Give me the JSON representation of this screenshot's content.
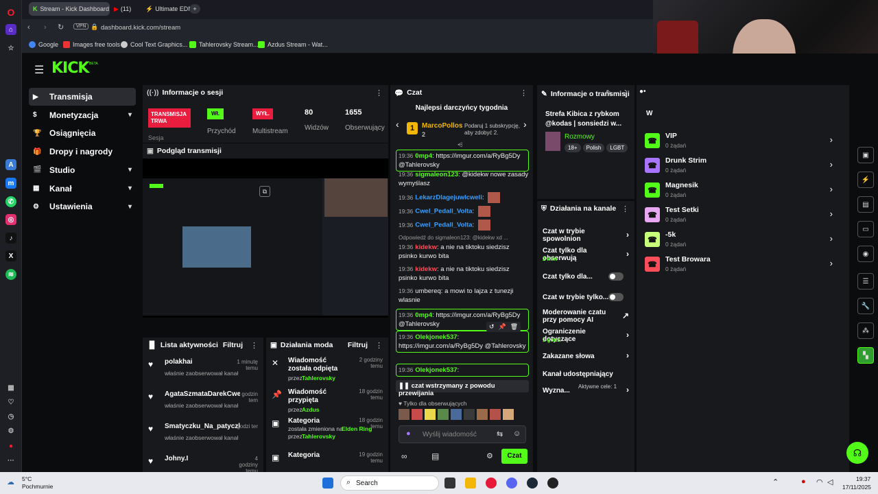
{
  "browser": {
    "tabs": [
      {
        "label": "Stream - Kick Dashboard"
      },
      {
        "label": "(11)"
      },
      {
        "label": "Ultimate EDM"
      }
    ],
    "url": "dashboard.kick.com/stream",
    "vpn": "VPN",
    "bookmarks": [
      "Google",
      "Images free tools",
      "Cool Text Graphics...",
      "Tahlerovsky Stream...",
      "Azdus Stream - Wat..."
    ]
  },
  "kick": {
    "logo": "KICK",
    "beta": "BETA"
  },
  "nav": [
    {
      "label": "Transmisja",
      "chev": ""
    },
    {
      "label": "Monetyzacja",
      "chev": "▾"
    },
    {
      "label": "Osiągnięcia",
      "chev": ""
    },
    {
      "label": "Dropy i nagrody",
      "chev": ""
    },
    {
      "label": "Studio",
      "chev": "▾"
    },
    {
      "label": "Kanał",
      "chev": "▾"
    },
    {
      "label": "Ustawienia",
      "chev": "▾"
    }
  ],
  "session": {
    "title": "Informacje o sesji",
    "badge1": "TRANSMISJA TRWA",
    "badge1_sub": "Sesja",
    "badge2": "Wł.",
    "badge2_sub": "Przychód",
    "badge3": "WYŁ.",
    "badge3_sub": "Multistream",
    "viewers": "80",
    "viewers_label": "Widzów",
    "followers": "1655",
    "followers_label": "Obserwujący"
  },
  "preview": {
    "title": "Podgląd transmisji"
  },
  "activity": {
    "title": "Lista aktywności",
    "filter": "Filtruj",
    "items": [
      {
        "name": "polakhai",
        "time": "1 minutę temu",
        "desc": "właśnie zaobserwował kanał"
      },
      {
        "name": "AgataSzmataDarekCwel",
        "time": "godzin tem",
        "desc": "właśnie zaobserwował kanał"
      },
      {
        "name": "Smatyczku_Na_patyczku",
        "time": "godzi ter",
        "desc": "właśnie zaobserwował kanał"
      },
      {
        "name": "Johny.I",
        "time": "4 godziny temu",
        "desc": ""
      }
    ]
  },
  "mod": {
    "title": "Działania moda",
    "filter": "Filtruj",
    "items": [
      {
        "title": "Wiadomość została odpięta",
        "by_label": "przez",
        "by": "Tahlerovsky",
        "time": "2 godziny temu",
        "extra_label": "",
        "extra": ""
      },
      {
        "title": "Wiadomość przypięta",
        "by_label": "przez",
        "by": "Azdus",
        "time": "18 godzin temu",
        "extra_label": "",
        "extra": ""
      },
      {
        "title": "Kategoria",
        "by_label": "przez",
        "by": "Tahlerovsky",
        "time": "18 godzin temu",
        "extra_label": "została zmieniona na",
        "extra": "Elden Ring"
      },
      {
        "title": "Kategoria",
        "by_label": "",
        "by": "",
        "time": "19 godzin temu",
        "extra_label": "",
        "extra": ""
      }
    ]
  },
  "chat": {
    "title": "Czat",
    "top_title": "Najlepsi darczyńcy tygodnia",
    "top_user": "MarcoPollos",
    "top_rank": "1",
    "top_count": "2",
    "top_desc": "Podaruj 1 subskrypcję, aby zdobyć 2.",
    "messages": [
      {
        "time": "19:36",
        "user": "0mp4",
        "text": "https://imgur.com/a/RyBg5Dy @Tahlerovsky"
      },
      {
        "time": "19:36",
        "user": "sigmaleon123",
        "text": "@kidekw nowe zasady wymyślasz"
      },
      {
        "time": "19:36",
        "user": "LekarzDlagejuwlcweli",
        "text": ""
      },
      {
        "time": "19:36",
        "user": "Cwel_Pedall_Volta",
        "text": ""
      },
      {
        "time": "19:36",
        "user": "Cwel_Pedall_Volta",
        "text": ""
      },
      {
        "time": "",
        "user": "",
        "text": "Odpowiedź do sigmaleon123: @kidekw xd ..."
      },
      {
        "time": "19:36",
        "user": "kidekw",
        "text": "a nie na tiktoku siedzisz psinko kurwo bita"
      },
      {
        "time": "19:36",
        "user": "kidekw",
        "text": "a nie na tiktoku siedzisz psinko kurwo bita"
      },
      {
        "time": "19:36",
        "user": "umbereq",
        "text": "a mowi to lajza z tunezji wlasnie"
      },
      {
        "time": "19:36",
        "user": "0mp4",
        "text": "https://imgur.com/a/RyBg5Dy @Tahlerovsky"
      },
      {
        "time": "19:36",
        "user": "Olekjonek537",
        "text": "https://imgur.com/a/RyBg5Dy @Tahlerovsky"
      },
      {
        "time": "19:36",
        "user": "Olekjonek537",
        "text": ""
      }
    ],
    "paused": "czat wstrzymany z powodu przewijania",
    "followers_only": "Tylko dla obserwujących",
    "placeholder": "Wyślij wiadomość",
    "send": "Czat"
  },
  "info": {
    "title": "Informacje o transmisji",
    "stream_title": "Strefa Kibica z rybkom @kodas | sonsiedzi w...",
    "category": "Rozmowy",
    "tags": [
      "18+",
      "Polish",
      "LGBT"
    ]
  },
  "actions": {
    "title": "Działania na kanale",
    "items": [
      {
        "label": "Czat w trybie spowolnion",
        "sub": "",
        "ctrl": "›"
      },
      {
        "label": "Czat tylko dla obserwują",
        "sub": "2 min",
        "ctrl": "›"
      },
      {
        "label": "Czat tylko dla...",
        "sub": "",
        "ctrl": "toggle"
      },
      {
        "label": "Czat w trybie tylko...",
        "sub": "",
        "ctrl": "toggle"
      },
      {
        "label": "Moderowanie czatu przy pomocy AI",
        "sub": "",
        "ctrl": "↗"
      },
      {
        "label": "Ograniczenie dotyczące",
        "sub": "1 godz.",
        "ctrl": "›"
      },
      {
        "label": "Zakazane słowa",
        "sub": "",
        "ctrl": "›"
      },
      {
        "label": "Kanał udostępniający",
        "sub": "",
        "ctrl": ""
      },
      {
        "label": "Wyzna...",
        "sub": "Aktywne cele: 1",
        "ctrl": "›"
      }
    ]
  },
  "groups": [
    {
      "name": "VIP",
      "sub": "0 żądań",
      "color": "#53fc18"
    },
    {
      "name": "Drunk Strim",
      "sub": "0 żądań",
      "color": "#a974ff"
    },
    {
      "name": "Magnesik",
      "sub": "0 żądań",
      "color": "#53fc18"
    },
    {
      "name": "Test Setki",
      "sub": "0 żądań",
      "color": "#e9a6f2"
    },
    {
      "name": "-5k",
      "sub": "0 żądań",
      "color": "#c8ff7a"
    },
    {
      "name": "Test Browara",
      "sub": "0 żądań",
      "color": "#ff4d5a"
    }
  ],
  "taskbar": {
    "temp": "5°C",
    "weather": "Pochmurnie",
    "search": "Search",
    "time": "19:37",
    "date": "17/11/2025"
  }
}
